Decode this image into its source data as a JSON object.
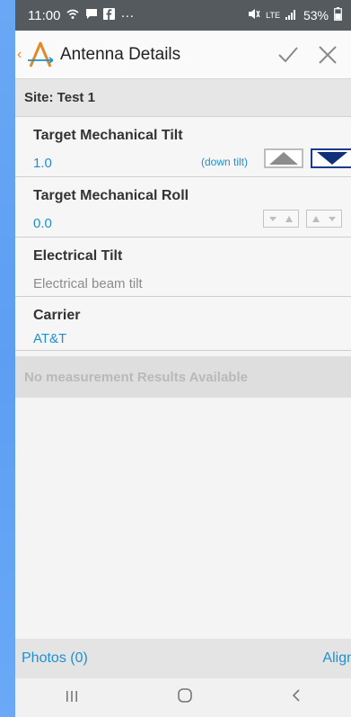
{
  "status": {
    "time": "11:00",
    "more": "···",
    "network": "LTE",
    "battery": "53%",
    "icons": [
      "wifi-call-icon",
      "message-icon",
      "facebook-icon",
      "mute-icon",
      "signal-icon",
      "battery-icon"
    ]
  },
  "appbar": {
    "title": "Antenna Details",
    "confirm_icon": "checkmark-icon",
    "close_icon": "close-icon",
    "accent_color": "#e08a2a"
  },
  "site": {
    "label": "Site: Test 1"
  },
  "fields": {
    "mech_tilt": {
      "label": "Target Mechanical Tilt",
      "value": "1.0",
      "hint": "(down tilt)"
    },
    "mech_roll": {
      "label": "Target Mechanical Roll",
      "value": "0.0"
    },
    "elec_tilt": {
      "label": "Electrical Tilt",
      "placeholder": "Electrical beam tilt"
    },
    "carrier": {
      "label": "Carrier",
      "value": "AT&T"
    }
  },
  "measurements": {
    "empty_text": "No measurement Results Available"
  },
  "bottom": {
    "photos": "Photos (0)",
    "align": "Align"
  },
  "navbar": {
    "recents": "|||",
    "home": "○",
    "back": "<"
  },
  "colors": {
    "link": "#1e8fd0",
    "selected_border": "#1a3c8f"
  }
}
